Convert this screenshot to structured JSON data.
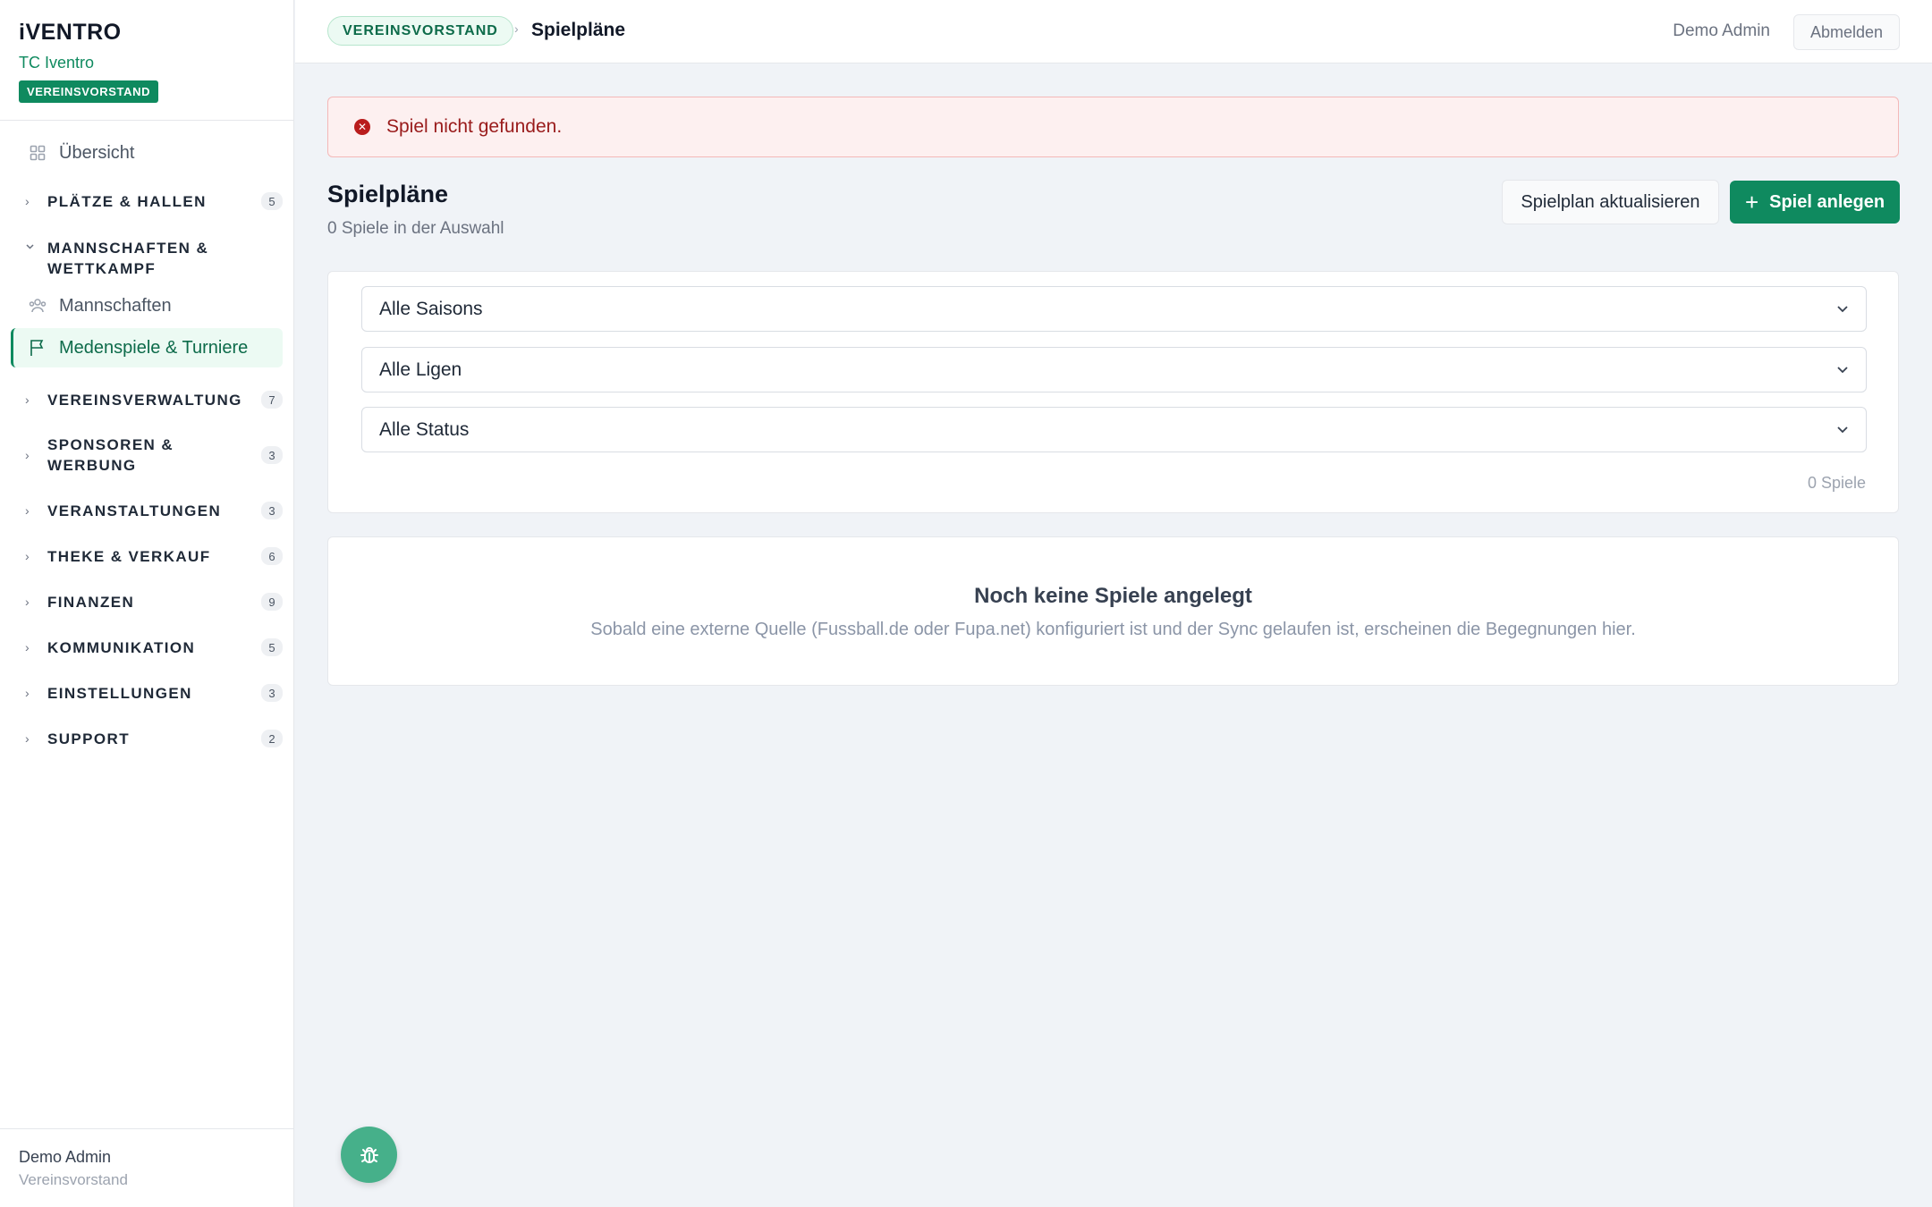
{
  "brand": {
    "logo": "iVENTRO",
    "club": "TC Iventro",
    "role_badge": "VEREINSVORSTAND"
  },
  "sidebar": {
    "overview": {
      "label": "Übersicht",
      "icon": "grid-icon"
    },
    "groups": [
      {
        "label": "PLÄTZE & HALLEN",
        "count": "5",
        "expanded": false
      },
      {
        "label": "MANNSCHAFTEN & WETTKAMPF",
        "count": "",
        "expanded": true
      },
      {
        "label": "VEREINSVERWALTUNG",
        "count": "7",
        "expanded": false
      },
      {
        "label": "SPONSOREN & WERBUNG",
        "count": "3",
        "expanded": false
      },
      {
        "label": "VERANSTALTUNGEN",
        "count": "3",
        "expanded": false
      },
      {
        "label": "THEKE & VERKAUF",
        "count": "6",
        "expanded": false
      },
      {
        "label": "FINANZEN",
        "count": "9",
        "expanded": false
      },
      {
        "label": "KOMMUNIKATION",
        "count": "5",
        "expanded": false
      },
      {
        "label": "EINSTELLUNGEN",
        "count": "3",
        "expanded": false
      },
      {
        "label": "SUPPORT",
        "count": "2",
        "expanded": false
      }
    ],
    "sub_items": [
      {
        "label": "Mannschaften",
        "icon": "users-icon",
        "active": false
      },
      {
        "label": "Medenspiele & Turniere",
        "icon": "flag-icon",
        "active": true
      }
    ],
    "footer": {
      "name": "Demo Admin",
      "role": "Vereinsvorstand"
    }
  },
  "topbar": {
    "badge": "VEREINSVORSTAND",
    "separator": "›",
    "title": "Spielpläne",
    "user": "Demo Admin",
    "logout": "Abmelden"
  },
  "alert": {
    "text": "Spiel nicht gefunden.",
    "color": "#991b1b"
  },
  "page": {
    "title": "Spielpläne",
    "subtitle": "0 Spiele in der Auswahl",
    "refresh_button": "Spielplan aktualisieren",
    "add_button": "Spiel anlegen"
  },
  "filters": {
    "season": "Alle Saisons",
    "league": "Alle Ligen",
    "status": "Alle Status",
    "count": "0 Spiele"
  },
  "empty": {
    "title": "Noch keine Spiele angelegt",
    "description": "Sobald eine externe Quelle (Fussball.de oder Fupa.net) konfiguriert ist und der Sync gelaufen ist, erscheinen die Begegnungen hier."
  },
  "colors": {
    "accent": "#0f8a5f",
    "fab": "#46b08a",
    "alert_bg": "#fdf0f0"
  }
}
